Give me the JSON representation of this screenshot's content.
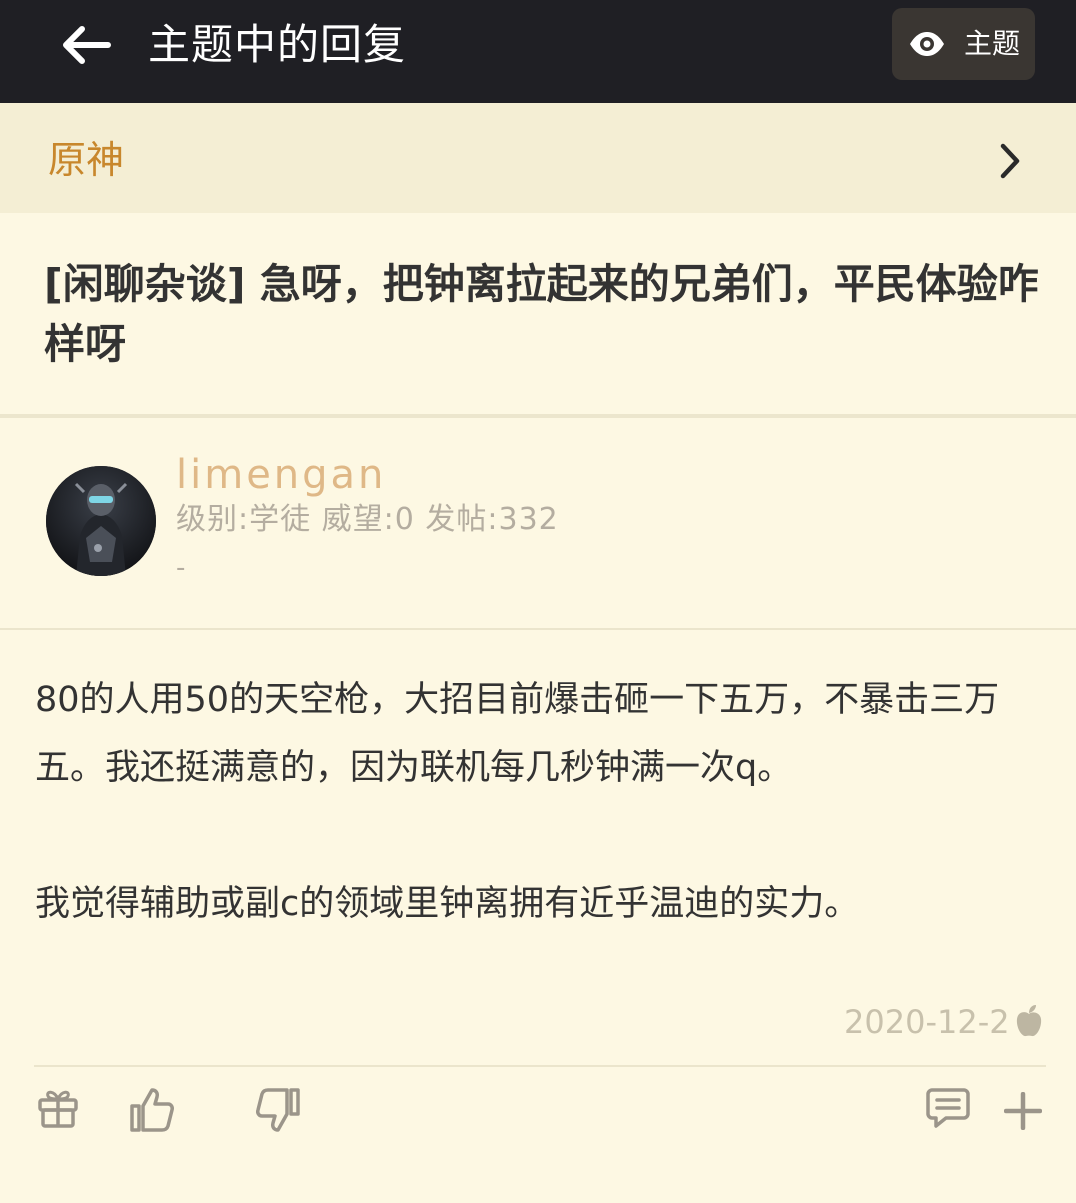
{
  "header": {
    "title": "主题中的回复",
    "topic_button_label": "主题",
    "back_icon": "back-arrow-icon",
    "eye_icon": "eye-icon"
  },
  "forum": {
    "name": "原神",
    "chevron_icon": "chevron-right-icon"
  },
  "thread": {
    "title": "[闲聊杂谈] 急呀，把钟离拉起来的兄弟们，平民体验咋样呀"
  },
  "author": {
    "name": "limengan",
    "stats": "级别:学徒 威望:0 发帖:332",
    "signature": "-"
  },
  "post": {
    "paragraph1": "80的人用50的天空枪，大招目前爆击砸一下五万，不暴击三万五。我还挺满意的，因为联机每几秒钟满一次q。",
    "paragraph2": "我觉得辅助或副c的领域里钟离拥有近乎温迪的实力。",
    "date": "2020-12-2",
    "device_icon": "apple-icon"
  },
  "actions": {
    "gift_icon": "gift-icon",
    "like_icon": "thumbs-up-icon",
    "dislike_icon": "thumbs-down-icon",
    "comment_icon": "comment-icon",
    "more_icon": "plus-icon"
  },
  "colors": {
    "topbar": "#1f1f24",
    "background": "#fdf8e3",
    "forum_bar": "#f4eed4",
    "forum_name": "#c8872c",
    "username": "#dfb887",
    "meta_text": "#b4ada0",
    "body_text": "#333333"
  }
}
